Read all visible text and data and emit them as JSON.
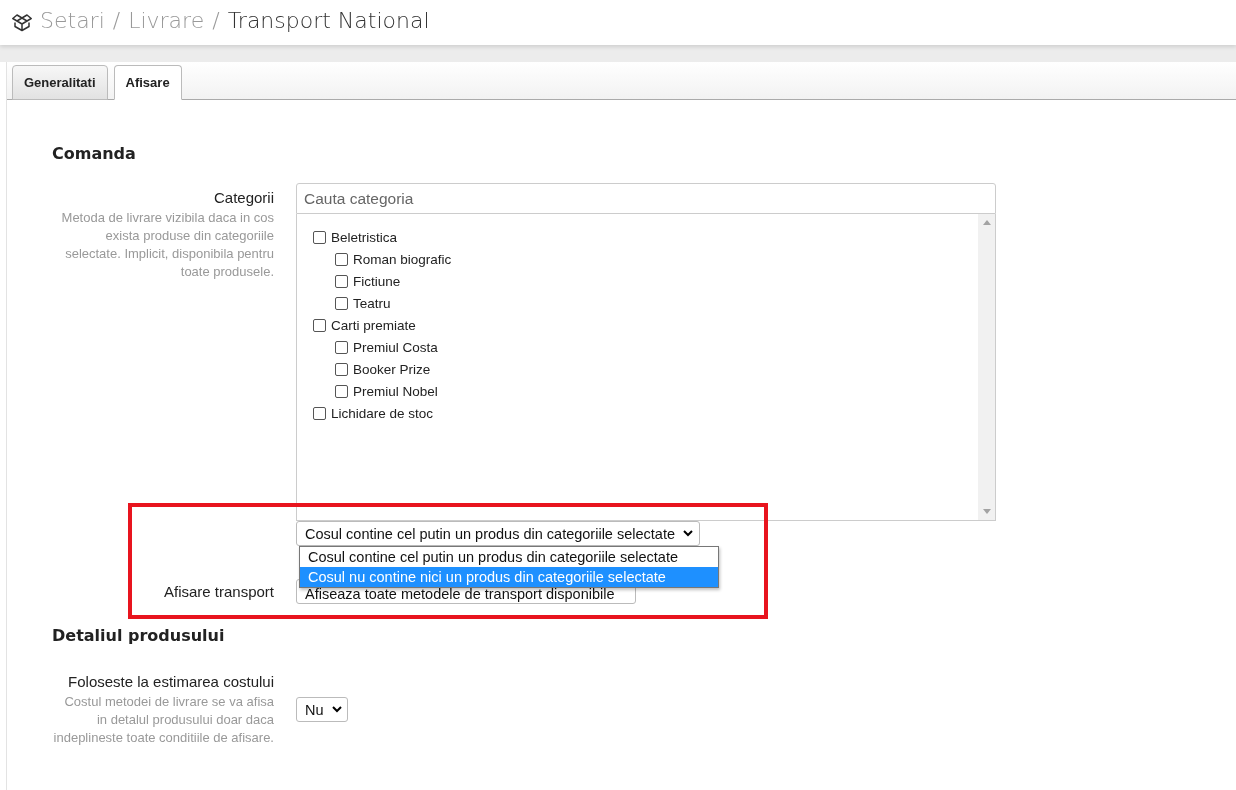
{
  "breadcrumb_separator": "/",
  "breadcrumb": [
    {
      "label": "Setari",
      "current": false
    },
    {
      "label": "Livrare",
      "current": false
    },
    {
      "label": "Transport National",
      "current": true
    }
  ],
  "tabs": [
    {
      "label": "Generalitati",
      "selected": false
    },
    {
      "label": "Afisare",
      "selected": true
    }
  ],
  "sections": [
    {
      "title": "Comanda"
    },
    {
      "title": "Detaliul produsului"
    }
  ],
  "categories": {
    "label": "Categorii",
    "help": "Metoda de livrare vizibila daca in cos exista produse din categoriile selectate. Implicit, disponibila pentru toate produsele.",
    "search_placeholder": "Cauta categoria",
    "tree": [
      {
        "label": "Beletristica",
        "checked": false,
        "children": [
          {
            "label": "Roman biografic",
            "checked": false
          },
          {
            "label": "Fictiune",
            "checked": false
          },
          {
            "label": "Teatru",
            "checked": false
          }
        ]
      },
      {
        "label": "Carti premiate",
        "checked": false,
        "children": [
          {
            "label": "Premiul Costa",
            "checked": false
          },
          {
            "label": "Booker Prize",
            "checked": false
          },
          {
            "label": "Premiul Nobel",
            "checked": false
          }
        ]
      },
      {
        "label": "Lichidare de stoc",
        "checked": false
      }
    ]
  },
  "condition_select": {
    "value": "Cosul contine cel putin un produs din categoriile selectate",
    "expanded": true,
    "options": [
      {
        "label": "Cosul contine cel putin un produs din categoriile selectate",
        "highlighted": false
      },
      {
        "label": "Cosul nu contine nici un produs din categoriile selectate",
        "highlighted": true
      }
    ]
  },
  "transport_display": {
    "label": "Afisare transport",
    "value": "Afiseaza toate metodele de transport disponibile"
  },
  "cost_estimate": {
    "label": "Foloseste la estimarea costului",
    "help": "Costul metodei de livrare se va afisa in detalul produsului doar daca indeplineste toate conditiile de afisare.",
    "value": "Nu"
  },
  "highlight": {
    "shown": true
  }
}
